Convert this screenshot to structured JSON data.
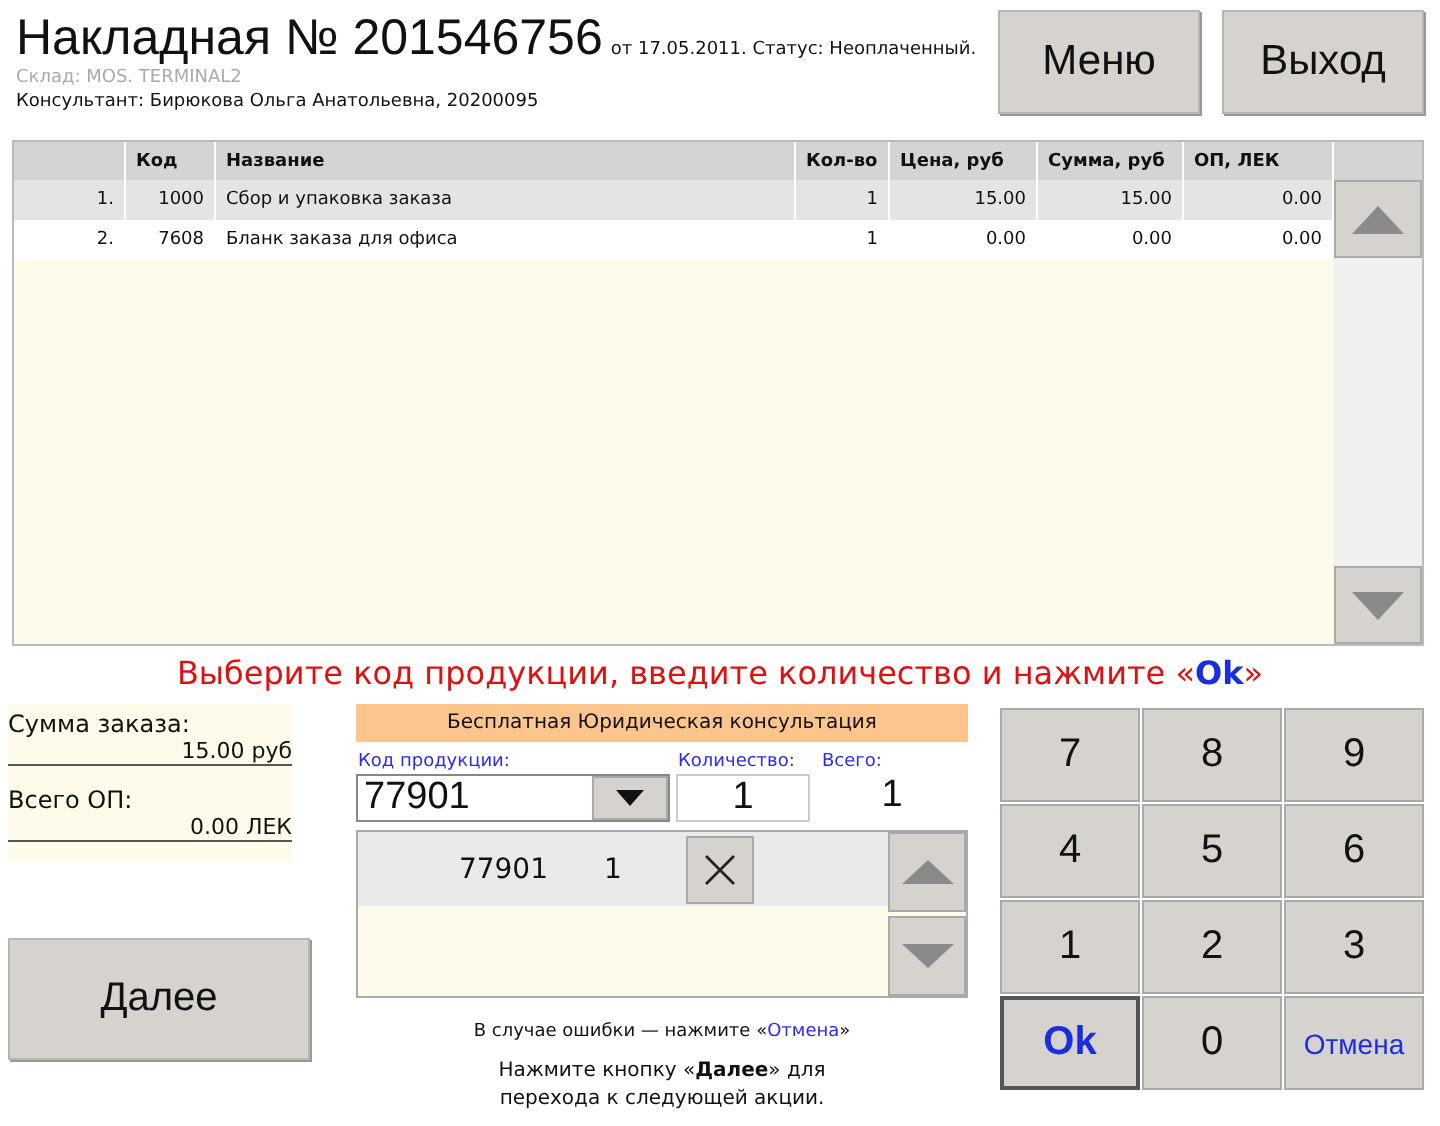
{
  "header": {
    "title": "Накладная № 201546756",
    "subtitle": "от 17.05.2011. Статус: Неоплаченный.",
    "warehouse": "Склад: MOS. TERMINAL2",
    "consultant": "Консультант: Бирюкова Ольга Анатольевна, 20200095"
  },
  "top_buttons": [
    "Меню",
    "Выход"
  ],
  "table": {
    "columns": [
      "",
      "Код",
      "Название",
      "Кол-во",
      "Цена, руб",
      "Сумма, руб",
      "ОП, ЛЕК"
    ],
    "rows": [
      {
        "cells": [
          "1.",
          "1000",
          "Сбор и упаковка заказа",
          "1",
          "15.00",
          "15.00",
          "0.00"
        ],
        "selected": true
      },
      {
        "cells": [
          "2.",
          "7608",
          "Бланк заказа для офиса",
          "1",
          "0.00",
          "0.00",
          "0.00"
        ],
        "selected": false
      }
    ]
  },
  "message": "Выберите код продукции, введите количество и нажмите «**Ok**»",
  "totals": [
    {
      "label": "Сумма заказа:",
      "value": "15.00 руб"
    },
    {
      "label": "Всего ОП:",
      "value": "0.00 ЛЕК"
    }
  ],
  "next_button": "Далее",
  "promo": "Бесплатная Юридическая консультация",
  "entry": {
    "code_label": "Код продукции:",
    "code": "77901",
    "qty_label": "Количество:",
    "qty": "1",
    "total_label": "Всего:",
    "total": "1"
  },
  "entries": [
    {
      "code": "77901",
      "qty": "1",
      "selected": true
    }
  ],
  "error_hint": "В случае ошибки — нажмите «Отмена»",
  "next_hint": "Нажмите кнопку «**Далее**» для перехода к следующей акции.",
  "keypad": [
    {
      "label": "7",
      "kind": "digit"
    },
    {
      "label": "8",
      "kind": "digit"
    },
    {
      "label": "9",
      "kind": "digit"
    },
    {
      "label": "4",
      "kind": "digit"
    },
    {
      "label": "5",
      "kind": "digit"
    },
    {
      "label": "6",
      "kind": "digit"
    },
    {
      "label": "1",
      "kind": "digit"
    },
    {
      "label": "2",
      "kind": "digit"
    },
    {
      "label": "3",
      "kind": "digit"
    },
    {
      "label": "Ok",
      "kind": "ok"
    },
    {
      "label": "0",
      "kind": "digit"
    },
    {
      "label": "Отмена",
      "kind": "cancel"
    }
  ]
}
